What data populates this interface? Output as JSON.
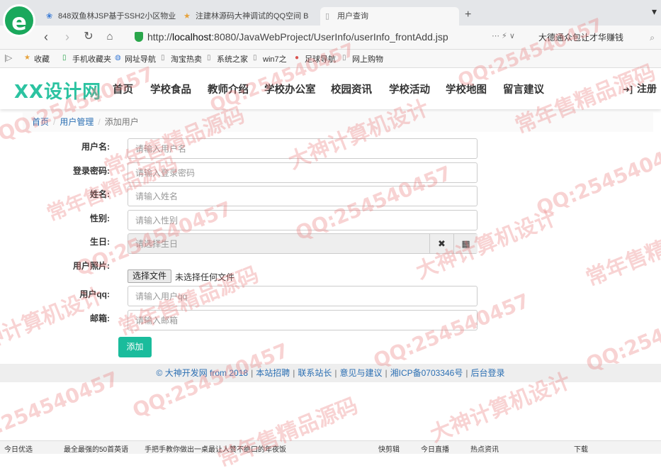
{
  "browser": {
    "tabs": [
      {
        "label": "848双鱼林JSP基于SSH2小区物业",
        "icon": "paw-icon"
      },
      {
        "label": "注建林源码大神调试的QQ空间 B",
        "icon": "star-icon"
      },
      {
        "label": "用户查询",
        "icon": "page-icon"
      }
    ],
    "new_tab": "+",
    "address": {
      "prefix": "http://",
      "host": "localhost",
      "path": ":8080/JavaWebProject/UserInfo/userInfo_frontAdd.jsp"
    },
    "search_text": "大德通众包让才华赚钱",
    "bookmarks": [
      "收藏",
      "手机收藏夹",
      "网址导航",
      "淘宝热卖",
      "系统之家",
      "win7之",
      "足球导航",
      "网上购物"
    ]
  },
  "site": {
    "logo": "XX设计网",
    "nav": [
      "首页",
      "学校食品",
      "教师介绍",
      "学校办公室",
      "校园资讯",
      "学校活动",
      "学校地图",
      "留言建议"
    ],
    "register": "注册",
    "breadcrumb": [
      "首页",
      "用户管理",
      "添加用户"
    ]
  },
  "form": {
    "fields": [
      {
        "label": "用户名:",
        "placeholder": "请输入用户名"
      },
      {
        "label": "登录密码:",
        "placeholder": "请输入登录密码"
      },
      {
        "label": "姓名:",
        "placeholder": "请输入姓名"
      },
      {
        "label": "性别:",
        "placeholder": "请输入性别"
      }
    ],
    "birthday": {
      "label": "生日:",
      "placeholder": "请选择生日",
      "clear_icon": "✖",
      "calendar_icon": "▦"
    },
    "photo": {
      "label": "用户照片:",
      "button": "选择文件",
      "status": "未选择任何文件"
    },
    "fields2": [
      {
        "label": "用户qq:",
        "placeholder": "请输入用户qq"
      },
      {
        "label": "邮箱:",
        "placeholder": "请输入邮箱"
      }
    ],
    "submit": "添加"
  },
  "footer": {
    "copyright": "© 大神开发网 from 2018",
    "links": [
      "本站招聘",
      "联系站长",
      "意见与建议",
      "湘ICP备0703346号",
      "后台登录"
    ]
  },
  "statusbar": [
    "今日优选",
    "最全最强的50首英语",
    "手把手教你做出一桌最让人赞不绝口的年夜饭",
    "快剪辑",
    "今日直播",
    "热点资讯",
    "下载"
  ],
  "watermark": [
    "QQ:254540457",
    "大神计算机设计",
    "常年售精品源码"
  ]
}
